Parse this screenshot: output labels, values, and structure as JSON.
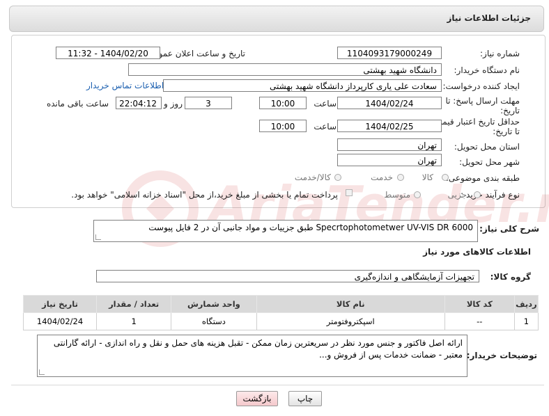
{
  "header": {
    "title": "جزئیات اطلاعات نیاز"
  },
  "fields": {
    "need_number_label": "شماره نیاز:",
    "need_number": "1104093179000249",
    "announce_label": "تاریخ و ساعت اعلان عمومی:",
    "announce_value": "1404/02/20 - 11:32",
    "buyer_org_label": "نام دستگاه خریدار:",
    "buyer_org": "دانشگاه شهید بهشتی",
    "creator_label": "ایجاد کننده درخواست:",
    "creator": "سعادت علی یاری کارپرداز دانشگاه شهید بهشتی",
    "contact_link": "اطلاعات تماس خریدار",
    "deadline_label_1": "مهلت ارسال پاسخ: تا",
    "deadline_label_2": "تاریخ:",
    "deadline_date": "1404/02/24",
    "time_label": "ساعت",
    "deadline_time": "10:00",
    "days_value": "3",
    "days_label": "روز و",
    "remaining_time": "22:04:12",
    "remaining_label": "ساعت باقی مانده",
    "validity_label_1": "حداقل تاریخ اعتبار قیمت:",
    "validity_label_2": "تا تاریخ:",
    "validity_date": "1404/02/25",
    "validity_time": "10:00",
    "province_label": "استان محل تحویل:",
    "province": "تهران",
    "city_label": "شهر محل تحویل:",
    "city": "تهران",
    "category_label": "طبقه بندی موضوعی:",
    "category_options": [
      "کالا",
      "خدمت",
      "کالا/خدمت"
    ],
    "process_label": "نوع فرآیند خرید :",
    "process_options": [
      "جزیی",
      "متوسط"
    ],
    "payment_note": "پرداخت تمام یا بخشی از مبلغ خرید،از محل \"اسناد خزانه اسلامی\" خواهد بود."
  },
  "summary": {
    "label": "شرح کلی نیاز:",
    "value": "Specrtophotometwer UV-VIS DR 6000 طبق جزییات و مواد جانبی آن در 2 فایل پیوست"
  },
  "goods": {
    "section_title": "اطلاعات کالاهای مورد نیاز",
    "group_label": "گروه کالا:",
    "group_value": "تجهیزات آزمایشگاهی و اندازه‌گیری"
  },
  "table": {
    "headers": [
      "ردیف",
      "کد کالا",
      "نام کالا",
      "واحد شمارش",
      "تعداد / مقدار",
      "تاریخ نیاز"
    ],
    "rows": [
      [
        "1",
        "--",
        "اسپکتروفتومتر",
        "دستگاه",
        "1",
        "1404/02/24"
      ]
    ]
  },
  "buyer_notes": {
    "label": "توضیحات خریدار:",
    "value": "ارائه اصل فاکتور و جنس مورد نظر در سریعترین زمان ممکن - تقبل هزینه های حمل و نقل و راه اندازی - ارائه گارانتی معتبر - ضمانت خدمات پس از فروش و..."
  },
  "buttons": {
    "print": "چاپ",
    "back": "بازگشت"
  },
  "watermark": {
    "text": "AriaTender.net"
  }
}
